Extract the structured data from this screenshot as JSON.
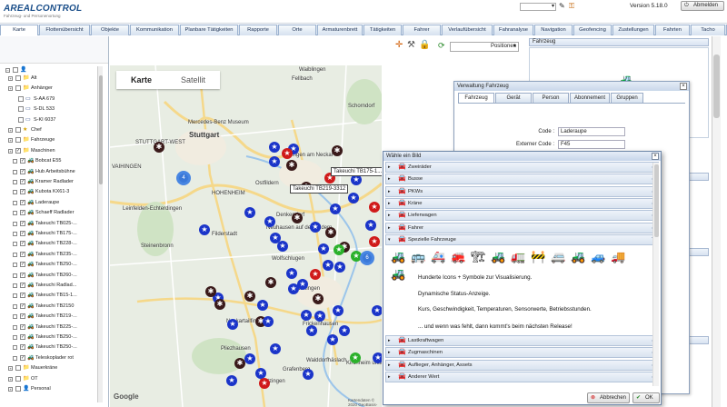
{
  "header": {
    "logo": "AREALCONTROL",
    "logo_sub": "Fahrzeug- und Personenortung",
    "version": "Version 5.18.0",
    "logout_label": "Abmelden"
  },
  "tabs": [
    "Karte",
    "Flottenübersicht",
    "Objekte",
    "Kommunikation",
    "Planbare Tätigkeiten",
    "Rapporte",
    "Orte",
    "Armaturenbrett",
    "Tätigkeiten",
    "Fahrer",
    "Verlaufübersicht",
    "Fahranalyse",
    "Navigation",
    "Geofencing",
    "Zustellungen",
    "Fahrten",
    "Tacho",
    "+"
  ],
  "tree": {
    "items": [
      {
        "label": "Alt",
        "indent": 1,
        "check": "",
        "icon": "folder"
      },
      {
        "label": "Anhänger",
        "indent": 1,
        "check": "",
        "icon": "folder"
      },
      {
        "label": "S-AA 679",
        "indent": 3,
        "check": "",
        "icon": "trailer"
      },
      {
        "label": "S-DL 533",
        "indent": 3,
        "check": "",
        "icon": "trailer"
      },
      {
        "label": "S-KI 6037",
        "indent": 3,
        "check": "",
        "icon": "trailer"
      },
      {
        "label": "Chef",
        "indent": 1,
        "check": "",
        "icon": "star"
      },
      {
        "label": "Fahrzeuge",
        "indent": 1,
        "check": "",
        "icon": "folder"
      },
      {
        "label": "Maschinen",
        "indent": 1,
        "check": "✓",
        "icon": "folder"
      },
      {
        "label": "Bobcat E55",
        "indent": 2,
        "check": "✓",
        "icon": "machine"
      },
      {
        "label": "Hub Arbeitsbühne",
        "indent": 2,
        "check": "✓",
        "icon": "machine"
      },
      {
        "label": "Kramer Radlader",
        "indent": 2,
        "check": "✓",
        "icon": "machine"
      },
      {
        "label": "Kubota KX61-3",
        "indent": 2,
        "check": "✓",
        "icon": "machine"
      },
      {
        "label": "Laderaupe",
        "indent": 2,
        "check": "✓",
        "icon": "machine"
      },
      {
        "label": "Schaeff Radlader",
        "indent": 2,
        "check": "✓",
        "icon": "machine"
      },
      {
        "label": "Takeuchi TB025-...",
        "indent": 2,
        "check": "✓",
        "icon": "machine"
      },
      {
        "label": "Takeuchi TB175-...",
        "indent": 2,
        "check": "✓",
        "icon": "machine"
      },
      {
        "label": "Takeuchi TB228-...",
        "indent": 2,
        "check": "✓",
        "icon": "machine"
      },
      {
        "label": "Takeuchi TB235-...",
        "indent": 2,
        "check": "✓",
        "icon": "machine"
      },
      {
        "label": "Takeuchi TB250-...",
        "indent": 2,
        "check": "✓",
        "icon": "machine"
      },
      {
        "label": "Takeuchi TB260-...",
        "indent": 2,
        "check": "✓",
        "icon": "machine"
      },
      {
        "label": "Takeuchi Radlad...",
        "indent": 2,
        "check": "✓",
        "icon": "machine"
      },
      {
        "label": "Takeuchi TB15-1...",
        "indent": 2,
        "check": "✓",
        "icon": "machine"
      },
      {
        "label": "Takeuchi TB2150",
        "indent": 2,
        "check": "✓",
        "icon": "machine"
      },
      {
        "label": "Takeuchi TB219-...",
        "indent": 2,
        "check": "✓",
        "icon": "machine"
      },
      {
        "label": "Takeuchi TB225-...",
        "indent": 2,
        "check": "✓",
        "icon": "machine"
      },
      {
        "label": "Takeuchi TB250-...",
        "indent": 2,
        "check": "✓",
        "icon": "machine"
      },
      {
        "label": "Takeuchi TB250-...",
        "indent": 2,
        "check": "✓",
        "icon": "machine"
      },
      {
        "label": "Teleskoplader rot",
        "indent": 2,
        "check": "✓",
        "icon": "machine"
      },
      {
        "label": "Mauerkräne",
        "indent": 1,
        "check": "",
        "icon": "folder"
      },
      {
        "label": "OT",
        "indent": 1,
        "check": "",
        "icon": "folder"
      },
      {
        "label": "Personal",
        "indent": 1,
        "check": "",
        "icon": "person"
      }
    ]
  },
  "map": {
    "type_map": "Karte",
    "type_satellite": "Satellit",
    "google": "Google",
    "attribution": "Kartendaten © 2020 GeoBasis-DE/BKG",
    "labels": [
      {
        "t": "Fellbach"
      },
      {
        "t": "Waiblingen"
      },
      {
        "t": "Mercedes-Benz Museum"
      },
      {
        "t": "Stuttgart"
      },
      {
        "t": "STUTTGART-WEST"
      },
      {
        "t": "Esslingen am Neckar"
      },
      {
        "t": "VAIHINGEN"
      },
      {
        "t": "Ostfildern"
      },
      {
        "t": "HOHENHEIM"
      },
      {
        "t": "Leinfelden-Echterdingen"
      },
      {
        "t": "Filderstadt"
      },
      {
        "t": "Denkendorf"
      },
      {
        "t": "Neuhausen auf den Fildern"
      },
      {
        "t": "Steinenbronn"
      },
      {
        "t": "Wolfschlugen"
      },
      {
        "t": "Nürtingen"
      },
      {
        "t": "Neckartailfingen"
      },
      {
        "t": "Frickenhausen"
      },
      {
        "t": "Grafenberg"
      },
      {
        "t": "Pliezhausen"
      },
      {
        "t": "Metzingen"
      },
      {
        "t": "Schorndorf"
      },
      {
        "t": "Walddorfhäslach"
      },
      {
        "t": "Kirchheim unter Teck"
      }
    ],
    "popups": [
      "Takeuchi TB175-1...",
      "Takeuchi TB219-3312"
    ],
    "cluster_counts": [
      "4",
      "6"
    ]
  },
  "toolbar": {
    "positions_label": "Positionen"
  },
  "right_panel": {
    "title": "Fahrzeug",
    "section_labels": [
      "",
      "",
      ""
    ]
  },
  "vehicle_window": {
    "title": "Verwaltung Fahrzeug",
    "tabs": [
      "Fahrzeug",
      "Gerät",
      "Person",
      "Abonnement",
      "Gruppen"
    ],
    "fields": [
      {
        "key": "Code :",
        "value": "Laderaupe"
      },
      {
        "key": "Externer Code :",
        "value": "F45"
      }
    ]
  },
  "dialog": {
    "title": "Wähle ein Bild",
    "categories_top": [
      "Zweiräder",
      "Busse",
      "PKWs",
      "Kräne",
      "Lieferwagen",
      "Fahrer",
      "Spezielle Fahrzeuge"
    ],
    "categories_bottom": [
      "Lastkraftwagen",
      "Zugmaschinen",
      "Auflieger, Anhänger, Assets",
      "Anderer Wert"
    ],
    "texts": [
      "Hunderte Icons + Symbole zur Visualisierung.",
      "Dynamische Status-Anzeige.",
      "Kurs, Geschwindigkeit, Temperaturen, Sensorwerte, Betriebsstunden.",
      "... und wenn was fehlt, dann kommt's beim nächsten Release!"
    ],
    "cancel_label": "Abbrechen",
    "ok_label": "OK",
    "vehicle_icons": [
      "🚜",
      "🚌",
      "🚑",
      "🚒",
      "🏗",
      "🚜",
      "🚛",
      "🚧",
      "🚐",
      "🚜",
      "🚙",
      "🚚",
      "🚜"
    ]
  },
  "colors": {
    "tab_border": "#9db3d0",
    "marker_blue": "#1b35c9",
    "marker_brown": "#3a1a1a",
    "marker_red": "#d01a1a",
    "marker_green": "#2bb12b"
  }
}
